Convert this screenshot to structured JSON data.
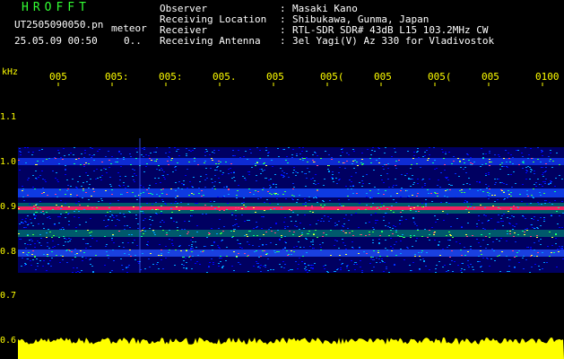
{
  "header": {
    "title": "HROFFT",
    "file_name": "UT2505090050.pn",
    "meteor_label": "meteor",
    "datetime": "25.05.09 00:50",
    "meteor_count": "0..",
    "info": [
      {
        "label": "Observer",
        "value": "Masaki Kano"
      },
      {
        "label": "Receiving Location",
        "value": "Shibukawa, Gunma, Japan"
      },
      {
        "label": "Receiver",
        "value": "RTL-SDR SDR# 43dB L15 103.2MHz CW"
      },
      {
        "label": "Receiving Antenna",
        "value": "3el Yagi(V) Az 330 for Vladivostok"
      }
    ]
  },
  "axes": {
    "unit": "kHz",
    "time_ticks": [
      "005",
      "005:",
      "005:",
      "005.",
      "005",
      "005(",
      "005",
      "005(",
      "005",
      "0100"
    ],
    "freq_ticks": [
      "1.1",
      "1.0",
      "0.9",
      "0.8",
      "0.7",
      "0.6"
    ]
  },
  "colors": {
    "background": "#000000",
    "text": "#ffffff",
    "title": "#33ff33",
    "ticks": "#ffff00",
    "spectrum_low": "#0000b0",
    "spectrum_mid": "#00ff80",
    "spectrum_peak": "#ff2060",
    "level_bar": "#ffff00"
  }
}
